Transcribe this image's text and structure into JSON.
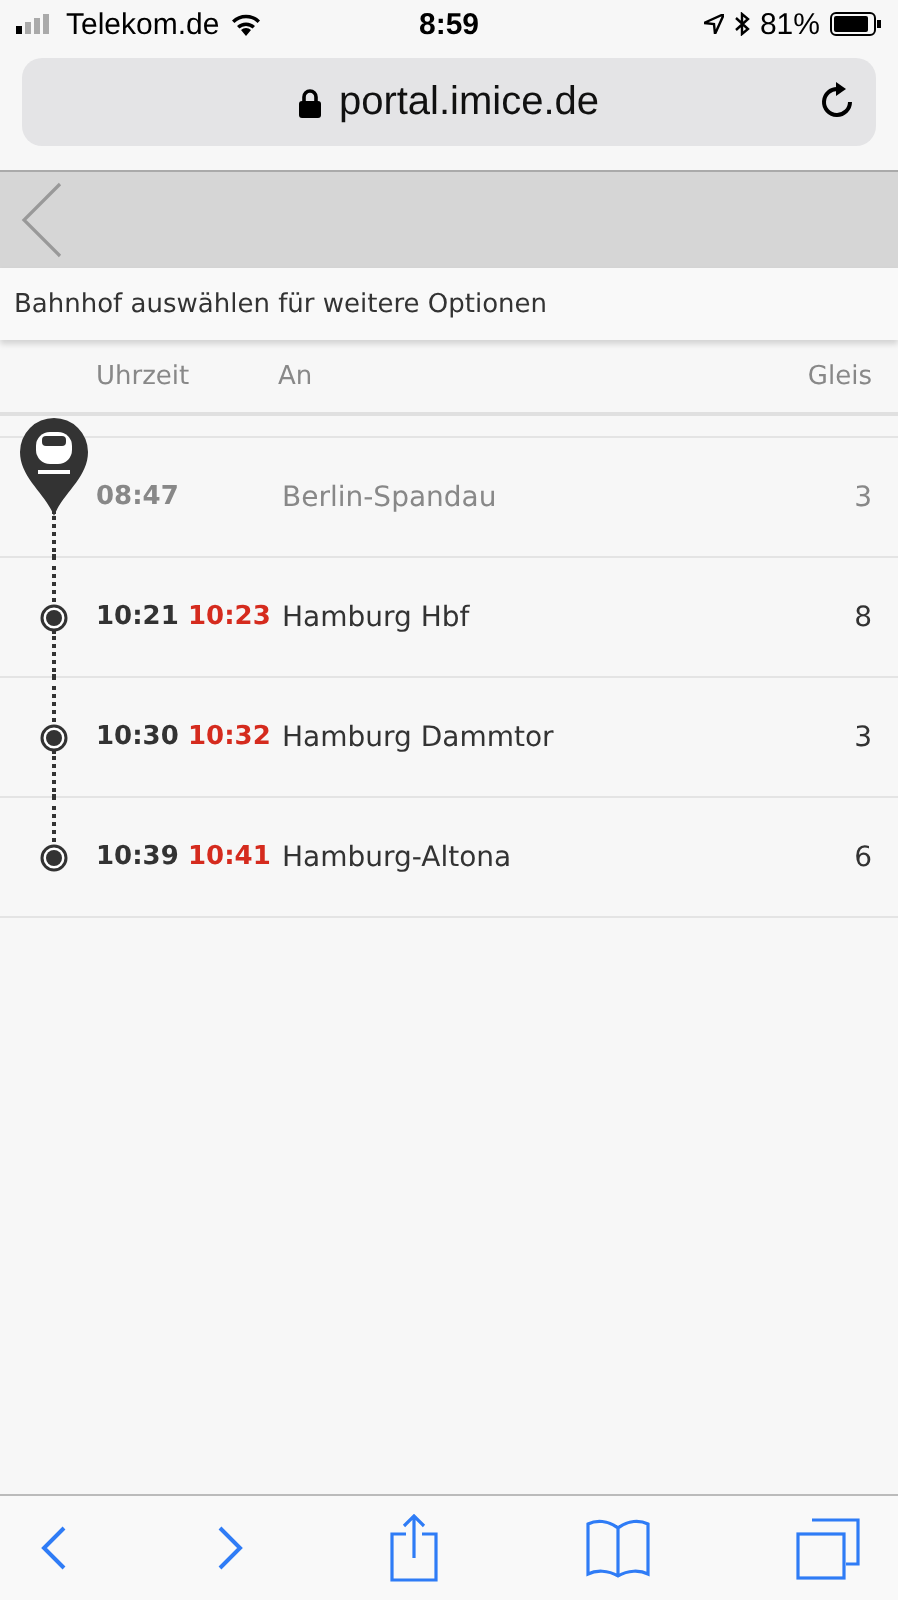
{
  "status_bar": {
    "carrier": "Telekom.de",
    "time": "8:59",
    "battery": "81%"
  },
  "address_bar": {
    "url": "portal.imice.de"
  },
  "info": "Bahnhof auswählen für weitere Optionen",
  "columns": [
    "Uhrzeit",
    "An",
    "Gleis"
  ],
  "rows": [
    {
      "kind": "origin",
      "time": "08:47",
      "station": "Berlin-Spandau",
      "platform": "3"
    },
    {
      "kind": "stop",
      "time": "10:21",
      "actual": "10:23",
      "station": "Hamburg Hbf",
      "platform": "8"
    },
    {
      "kind": "stop",
      "time": "10:30",
      "actual": "10:32",
      "station": "Hamburg Dammtor",
      "platform": "3"
    },
    {
      "kind": "stop",
      "time": "10:39",
      "actual": "10:41",
      "station": "Hamburg-Altona",
      "platform": "6"
    }
  ]
}
